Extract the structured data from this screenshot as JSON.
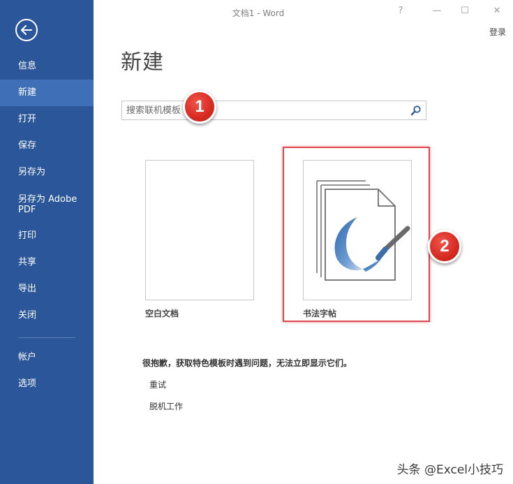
{
  "window": {
    "title": "文档1 - Word",
    "help": "?",
    "minimize": "—",
    "restore": "☐",
    "close": "✕",
    "signin": "登录"
  },
  "sidebar": {
    "items": [
      {
        "label": "信息"
      },
      {
        "label": "新建",
        "active": true
      },
      {
        "label": "打开"
      },
      {
        "label": "保存"
      },
      {
        "label": "另存为"
      },
      {
        "label": "另存为 Adobe",
        "label2": "PDF"
      },
      {
        "label": "打印"
      },
      {
        "label": "共享"
      },
      {
        "label": "导出"
      },
      {
        "label": "关闭"
      },
      {
        "label": "帐户"
      },
      {
        "label": "选项"
      }
    ]
  },
  "main": {
    "title": "新建",
    "search": {
      "placeholder": "搜索联机模板"
    },
    "templates": [
      {
        "label": "空白文档"
      },
      {
        "label": "书法字帖"
      }
    ],
    "error_message": "很抱歉，获取特色模板时遇到问题，无法立即显示它们。",
    "retry": "重试",
    "offline": "脱机工作"
  },
  "annotations": [
    "1",
    "2"
  ],
  "watermark": "头条 @Excel小技巧",
  "colors": {
    "sidebar": "#2b579a",
    "sidebar_active": "#3f6fb6",
    "highlight": "#e0474c",
    "badge": "#d62a22"
  }
}
